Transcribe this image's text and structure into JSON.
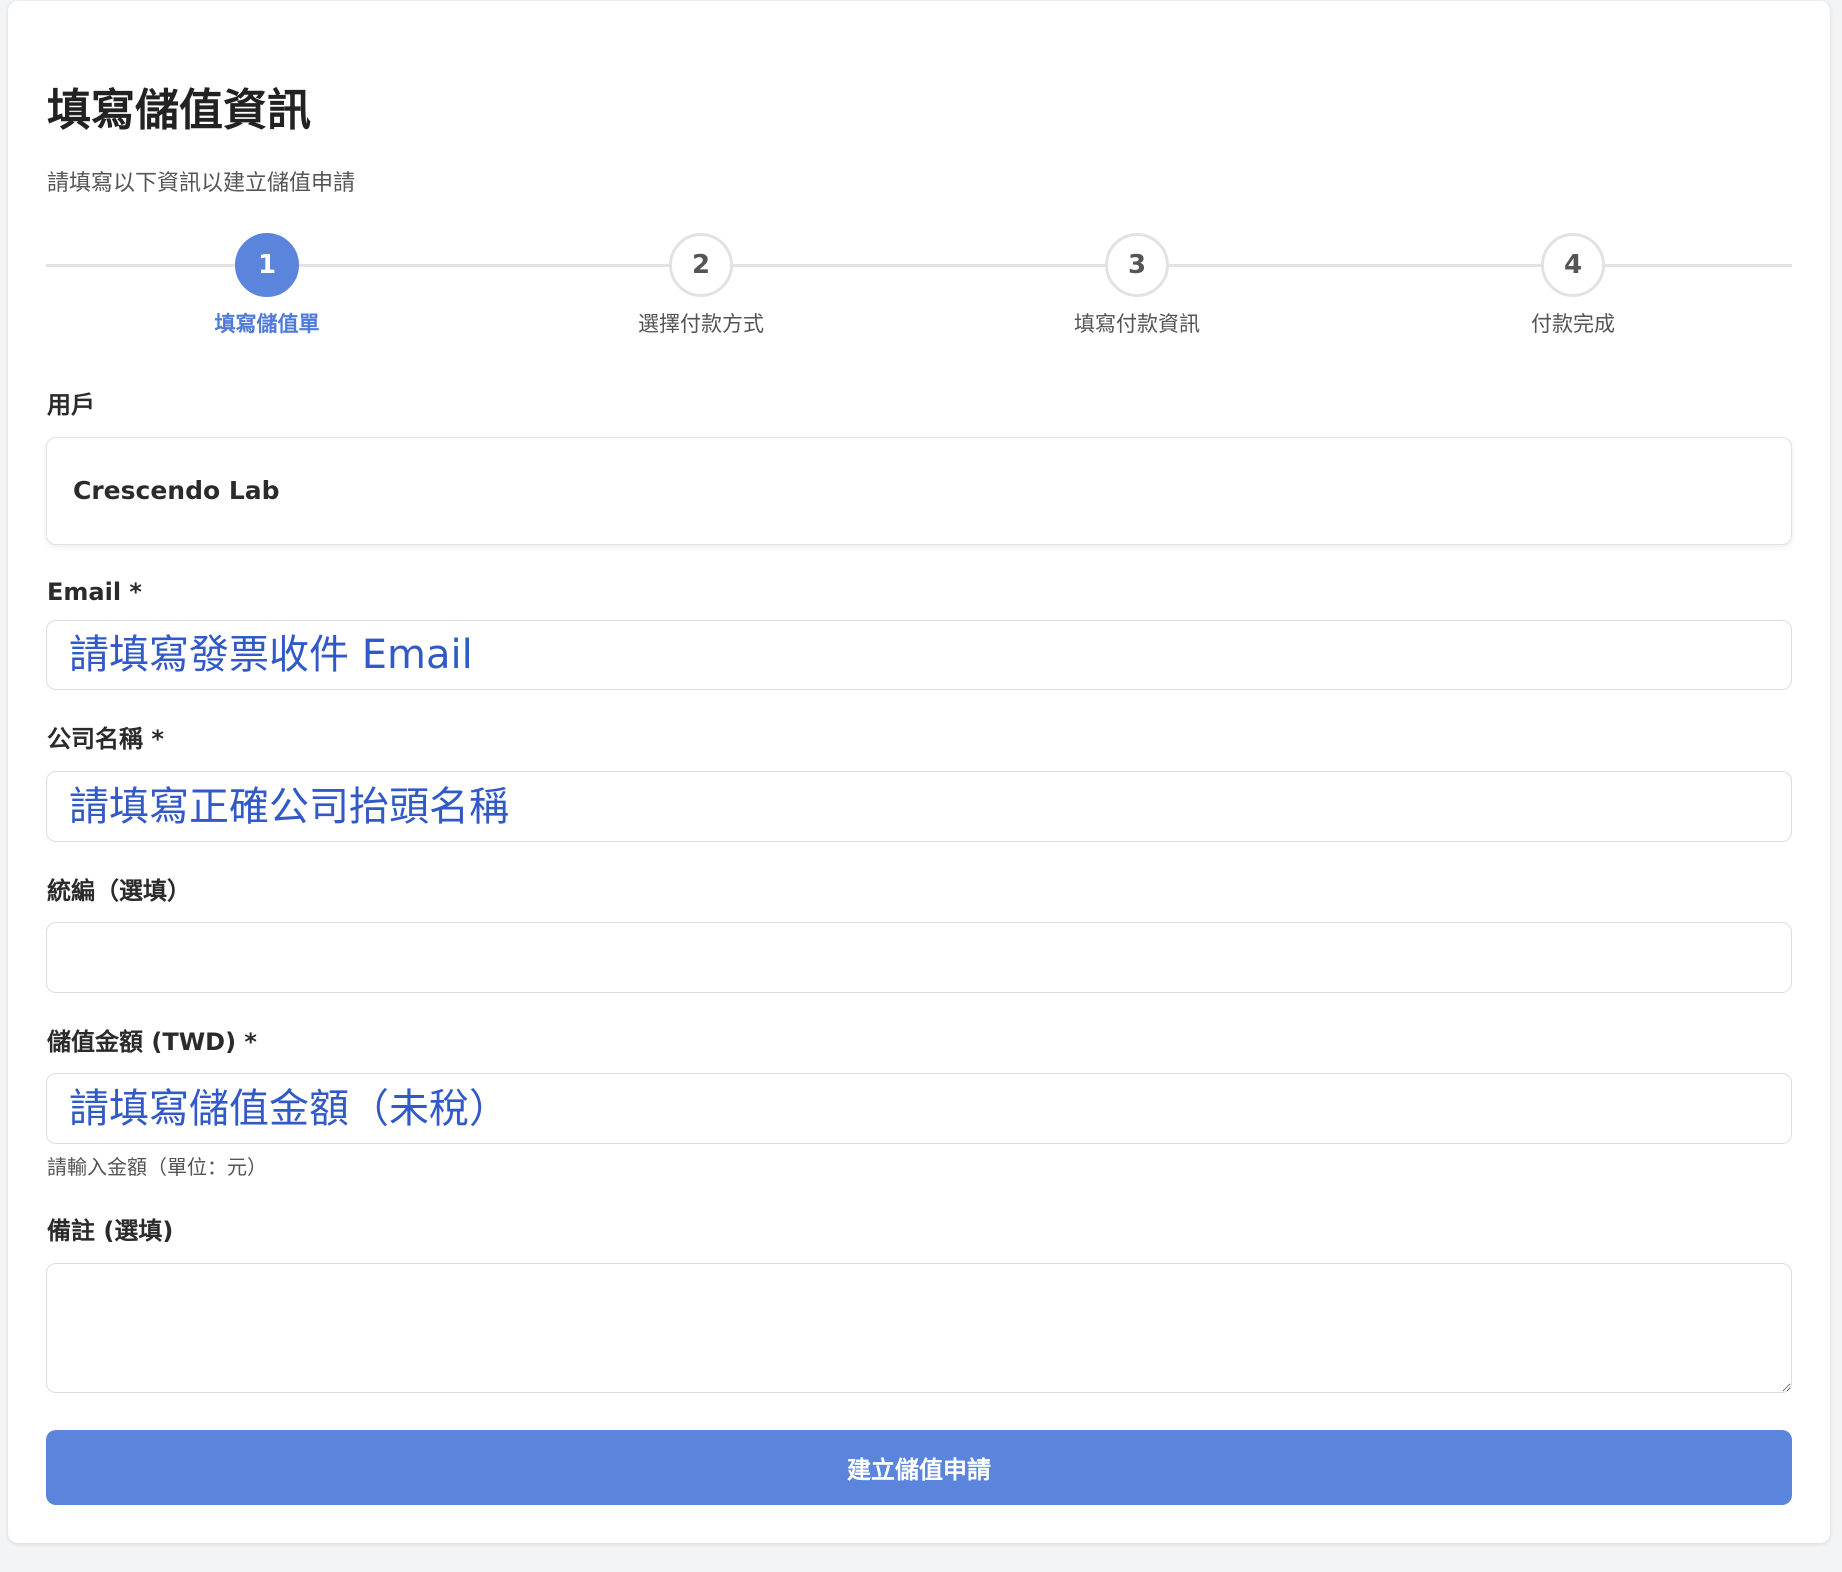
{
  "page": {
    "title": "填寫儲值資訊",
    "subtitle": "請填寫以下資訊以建立儲值申請"
  },
  "stepper": {
    "current_step": 1,
    "steps": [
      {
        "number": "1",
        "label": "填寫儲值單"
      },
      {
        "number": "2",
        "label": "選擇付款方式"
      },
      {
        "number": "3",
        "label": "填寫付款資訊"
      },
      {
        "number": "4",
        "label": "付款完成"
      }
    ]
  },
  "form": {
    "user": {
      "label": "用戶",
      "value": "Crescendo Lab"
    },
    "email": {
      "label": "Email *",
      "value": "",
      "placeholder": "請填寫發票收件 Email"
    },
    "company_name": {
      "label": "公司名稱 *",
      "value": "",
      "placeholder": "請填寫正確公司抬頭名稱"
    },
    "tax_id": {
      "label": "統編（選填）",
      "value": "",
      "placeholder": ""
    },
    "amount": {
      "label": "儲值金額 (TWD) *",
      "value": "",
      "placeholder": "請填寫儲值金額（未稅）",
      "hint": "請輸入金額（單位：元）"
    },
    "note": {
      "label": "備註 (選填)",
      "value": ""
    },
    "submit_label": "建立儲值申請"
  },
  "colors": {
    "primary": "#5b84dc",
    "active_step_text": "#4f7bd9",
    "placeholder_text": "#3159c8",
    "inactive_step_border": "#e2e2e2",
    "page_background": "#f3f4f6"
  }
}
